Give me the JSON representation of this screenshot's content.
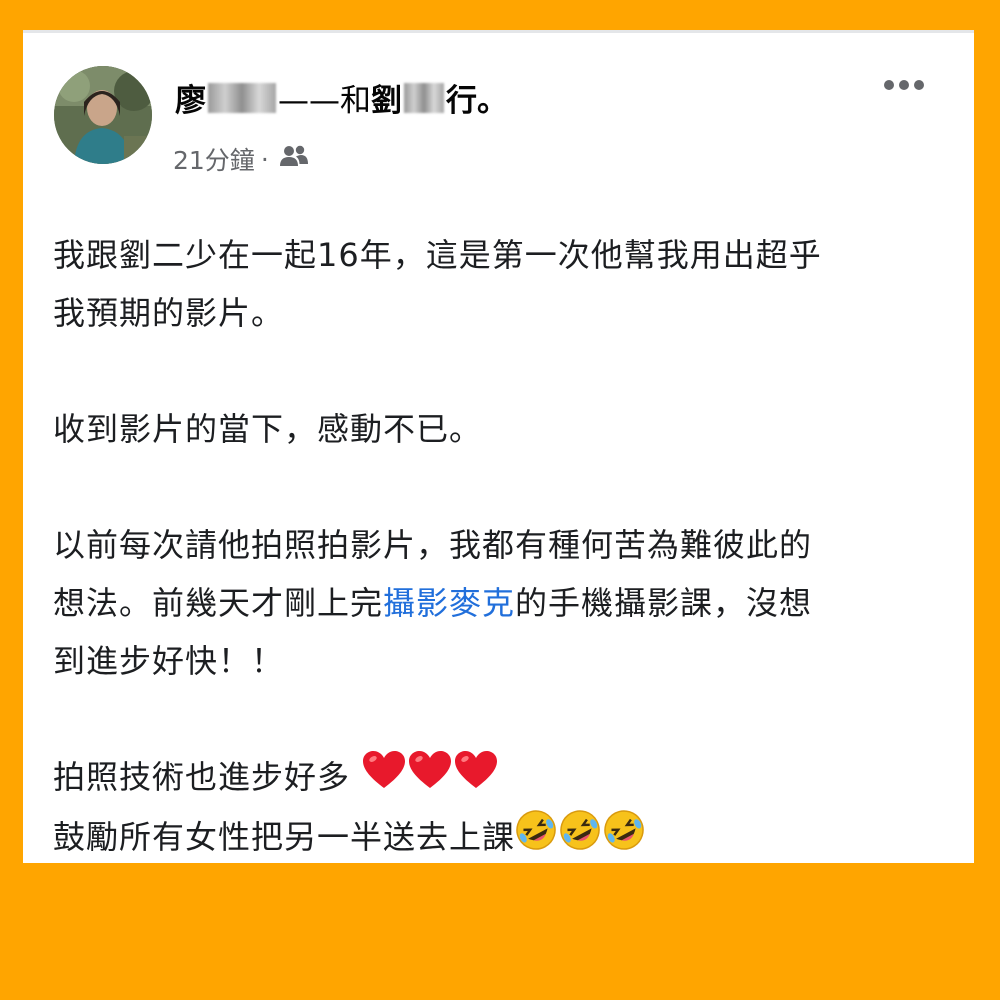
{
  "post": {
    "author": {
      "name_first": "廖",
      "connector": "——和",
      "with_first": "劉",
      "suffix": "行。"
    },
    "timestamp": "21分鐘",
    "separator": "·",
    "privacy_icon": "friends-icon",
    "more_icon": "more-options-icon",
    "lines": {
      "l1": "我跟劉二少在一起16年，這是第一次他幫我用出超乎",
      "l2": "我預期的影片。",
      "l3": "收到影片的當下，感動不已。",
      "l4": "以前每次請他拍照拍影片，我都有種何苦為難彼此的",
      "l5_before": "想法。前幾天才剛上完",
      "l5_link": "攝影麥克",
      "l5_after": "的手機攝影課，沒想",
      "l6": "到進步好快！！",
      "l7": "拍照技術也進步好多",
      "l8": "鼓勵所有女性把另一半送去上課"
    },
    "emoji": {
      "hearts": "red-heart-icon",
      "laughs": "rolling-on-floor-laughing-icon"
    }
  },
  "colors": {
    "background": "#FFA500",
    "card": "#ffffff",
    "text": "#1c1e21",
    "secondary_text": "#65676b",
    "link": "#216fdb",
    "heart": "#e8192c",
    "emoji_face": "#f7c21b"
  }
}
